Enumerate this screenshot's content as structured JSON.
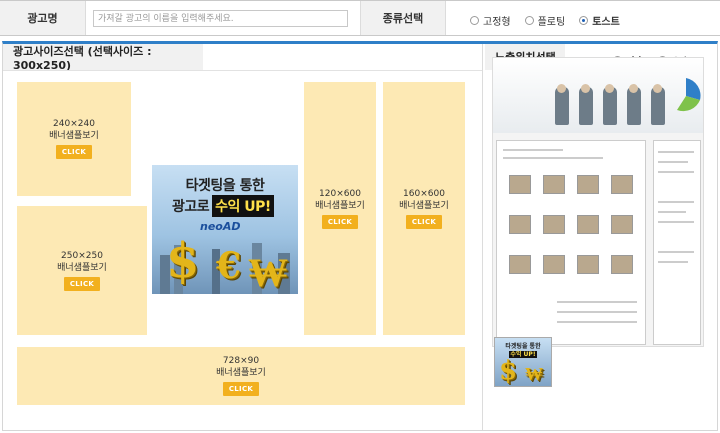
{
  "form": {
    "ad_name_label": "광고명",
    "ad_name_placeholder": "가져갈 광고의 이름을 입력해주세요.",
    "type_label": "종류선택",
    "type_options": [
      "고정형",
      "플로팅",
      "토스트"
    ],
    "type_selected": "토스트"
  },
  "size_section": {
    "title": "광고사이즈선택 (선택사이즈 : 300x250)"
  },
  "position_section": {
    "title": "노출위치선택",
    "options": [
      "좌측",
      "우측"
    ],
    "selected": "좌측"
  },
  "banners": [
    {
      "size": "240×240",
      "label": "배너샘플보기",
      "button": "CLICK"
    },
    {
      "size": "120×600",
      "label": "배너샘플보기",
      "button": "CLICK"
    },
    {
      "size": "160×600",
      "label": "배너샘플보기",
      "button": "CLICK"
    },
    {
      "size": "250×250",
      "label": "배너샘플보기",
      "button": "CLICK"
    },
    {
      "size": "728×90",
      "label": "배너샘플보기",
      "button": "CLICK"
    }
  ],
  "ad_preview": {
    "line1": "타겟팅을 통한",
    "line2_prefix": "광고로",
    "line2_highlight": "수익 UP!",
    "logo_neo": "neo",
    "logo_ad": "AD",
    "symbols": [
      "$",
      "€",
      "₩"
    ]
  },
  "colors": {
    "accent": "#2f7fc8",
    "tile_bg": "#fde9b4",
    "click_btn": "#f2b01e"
  }
}
